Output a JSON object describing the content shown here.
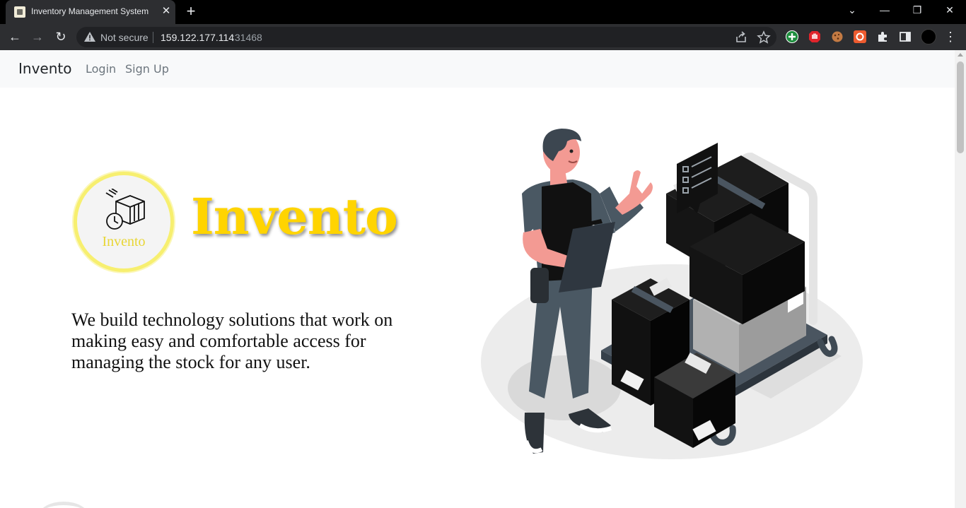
{
  "browser": {
    "tab_title": "Inventory Management System",
    "tab_close": "✕",
    "new_tab": "+",
    "window_controls": {
      "chevron": "⌄",
      "minimize": "—",
      "restore": "❐",
      "close": "✕"
    },
    "nav": {
      "back": "←",
      "forward": "→",
      "reload": "↻"
    },
    "security_label": "Not secure",
    "url_host": "159.122.177.114",
    "url_port": ":31468",
    "icons": [
      "warning-icon",
      "share-icon",
      "star-icon",
      "extension-green-icon",
      "extension-red-hand-icon",
      "cookie-icon",
      "extension-orange-icon",
      "puzzle-icon",
      "sidepanel-icon",
      "profile-avatar",
      "kebab-menu-icon"
    ],
    "menu": "⋮"
  },
  "navbar": {
    "brand": "Invento",
    "links": [
      "Login",
      "Sign Up"
    ]
  },
  "hero": {
    "badge_text": "Invento",
    "title": "Invento",
    "description": "We build technology solutions that work on making easy and comfortable access for managing the stock for any user.",
    "title_color": "#ffd400",
    "badge_ring_color": "#f7ef6f"
  }
}
